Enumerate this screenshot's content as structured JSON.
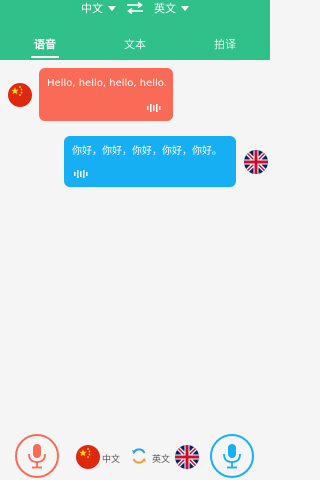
{
  "lang_bar": {
    "source_lang": "中文",
    "target_lang": "英文",
    "swap_icon": "swap-arrows-icon"
  },
  "tabs": [
    {
      "label": "语音",
      "active": true
    },
    {
      "label": "文本",
      "active": false
    },
    {
      "label": "拍译",
      "active": false
    }
  ],
  "messages": [
    {
      "side": "left",
      "flag": "china-flag-icon",
      "text": "Hello, hello, hello, hello.",
      "color": "#f96b56"
    },
    {
      "side": "right",
      "flag": "uk-flag-icon",
      "text": "你好，你好，你好，你好，你好。",
      "color": "#16aff4"
    }
  ],
  "bottom_bar": {
    "left_lang_label": "中文",
    "right_lang_label": "英文",
    "left_mic_color": "#f96b56",
    "right_mic_color": "#16aff4"
  },
  "colors": {
    "header": "#2fc189",
    "background": "#f5f5f5"
  }
}
